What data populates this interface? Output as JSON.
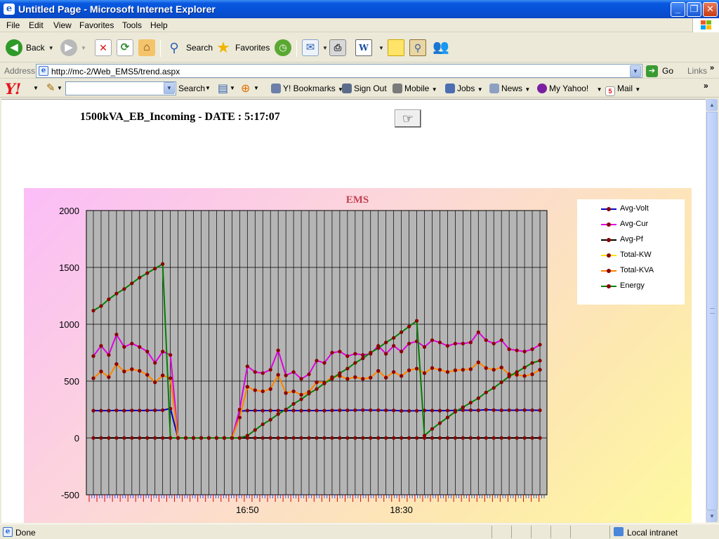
{
  "window": {
    "title": "Untitled Page - Microsoft Internet Explorer"
  },
  "menu": [
    "File",
    "Edit",
    "View",
    "Favorites",
    "Tools",
    "Help"
  ],
  "toolbar": {
    "back": "Back",
    "search": "Search",
    "favorites": "Favorites"
  },
  "address": {
    "label": "Address",
    "url": "http://mc-2/Web_EMS5/trend.aspx",
    "go": "Go",
    "links": "Links"
  },
  "yahoo": {
    "search_value": "",
    "items": [
      "Search",
      "Y! Bookmarks",
      "Sign Out",
      "Mobile",
      "Jobs",
      "News",
      "My Yahoo!",
      "Mail"
    ],
    "mail_count": "5"
  },
  "page": {
    "heading": "1500kVA_EB_Incoming - DATE : 5:17:07"
  },
  "status": {
    "text": "Done",
    "zone": "Local intranet"
  },
  "colors": {
    "titlebar": "#0551d8",
    "plot_bg": "#b5b5b5"
  },
  "chart_data": {
    "type": "line",
    "title": "EMS",
    "ylim": [
      -500,
      2000
    ],
    "yticks": [
      -500,
      0,
      500,
      1000,
      1500,
      2000
    ],
    "x_tick_labels": [
      {
        "index": 20,
        "label": "16:50"
      },
      {
        "index": 40,
        "label": "18:30"
      }
    ],
    "n_points": 59,
    "grid": true,
    "legend_position": "right",
    "series": [
      {
        "name": "Avg-Volt",
        "color": "#0000c0",
        "values": [
          240,
          240,
          240,
          242,
          240,
          242,
          241,
          242,
          243,
          244,
          258,
          0,
          0,
          0,
          0,
          0,
          0,
          0,
          0,
          235,
          241,
          241,
          240,
          241,
          241,
          241,
          241,
          240,
          241,
          241,
          240,
          242,
          243,
          243,
          244,
          245,
          244,
          244,
          243,
          242,
          238,
          238,
          239,
          242,
          241,
          240,
          241,
          242,
          244,
          244,
          243,
          248,
          245,
          243,
          244,
          244,
          245,
          244,
          243
        ]
      },
      {
        "name": "Avg-Cur",
        "color": "#e000e0",
        "values": [
          720,
          810,
          730,
          910,
          800,
          830,
          800,
          760,
          660,
          760,
          730,
          0,
          0,
          0,
          0,
          0,
          0,
          0,
          0,
          250,
          630,
          580,
          570,
          600,
          770,
          550,
          580,
          520,
          560,
          680,
          660,
          750,
          760,
          720,
          740,
          730,
          740,
          810,
          740,
          810,
          760,
          830,
          850,
          800,
          860,
          840,
          810,
          830,
          830,
          840,
          930,
          860,
          830,
          860,
          780,
          770,
          760,
          780,
          820
        ]
      },
      {
        "name": "Avg-Pf",
        "color": "#000000",
        "values": [
          0,
          0,
          0,
          0,
          0,
          0,
          0,
          0,
          0,
          0,
          0,
          0,
          0,
          0,
          0,
          0,
          0,
          0,
          0,
          0,
          0,
          0,
          0,
          0,
          0,
          0,
          0,
          0,
          0,
          0,
          0,
          0,
          0,
          0,
          0,
          0,
          0,
          0,
          0,
          0,
          0,
          0,
          0,
          0,
          0,
          0,
          0,
          0,
          0,
          0,
          0,
          0,
          0,
          0,
          0,
          0,
          0,
          0,
          0
        ]
      },
      {
        "name": "Total-KW",
        "color": "#ffe000",
        "values": [
          525,
          585,
          535,
          650,
          585,
          605,
          590,
          555,
          490,
          550,
          525,
          0,
          0,
          0,
          0,
          0,
          0,
          0,
          0,
          180,
          450,
          420,
          410,
          430,
          555,
          395,
          410,
          380,
          405,
          490,
          485,
          535,
          545,
          520,
          535,
          520,
          530,
          590,
          530,
          580,
          545,
          595,
          610,
          570,
          615,
          600,
          580,
          595,
          600,
          605,
          665,
          615,
          600,
          620,
          560,
          555,
          545,
          560,
          600
        ]
      },
      {
        "name": "Total-KVA",
        "color": "#ff8000",
        "values": [
          525,
          585,
          535,
          650,
          585,
          605,
          590,
          555,
          490,
          550,
          525,
          0,
          0,
          0,
          0,
          0,
          0,
          0,
          0,
          180,
          450,
          420,
          410,
          430,
          555,
          395,
          410,
          380,
          405,
          490,
          485,
          535,
          545,
          520,
          535,
          520,
          530,
          590,
          530,
          580,
          545,
          595,
          610,
          570,
          615,
          600,
          580,
          595,
          600,
          605,
          665,
          615,
          600,
          620,
          560,
          555,
          545,
          560,
          600
        ]
      },
      {
        "name": "Energy",
        "color": "#008000",
        "values": [
          1120,
          1160,
          1220,
          1270,
          1310,
          1360,
          1410,
          1450,
          1490,
          1530,
          0,
          0,
          0,
          0,
          0,
          0,
          0,
          0,
          0,
          0,
          20,
          70,
          120,
          160,
          210,
          250,
          300,
          340,
          390,
          430,
          480,
          520,
          570,
          610,
          660,
          700,
          750,
          790,
          840,
          880,
          930,
          980,
          1030,
          20,
          80,
          130,
          180,
          230,
          270,
          310,
          350,
          400,
          440,
          490,
          540,
          580,
          620,
          660,
          680
        ]
      }
    ]
  }
}
